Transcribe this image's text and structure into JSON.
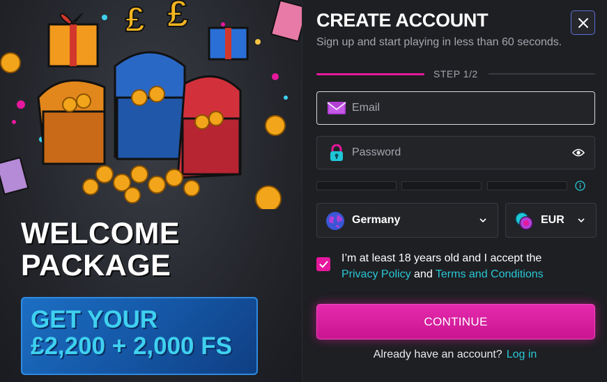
{
  "promo": {
    "headline_line1": "WELCOME",
    "headline_line2": "PACKAGE",
    "offer_line1": "GET YOUR",
    "offer_line2": "£2,200 + 2,000 FS"
  },
  "form": {
    "title": "CREATE ACCOUNT",
    "subtitle": "Sign up and start playing in less than 60 seconds.",
    "step_label": "STEP  1/2",
    "email_placeholder": "Email",
    "password_placeholder": "Password",
    "country": "Germany",
    "currency": "EUR",
    "consent_prefix": "I’m at least 18 years old and I accept the",
    "privacy_link": "Privacy Policy",
    "consent_and": "and",
    "terms_link": "Terms and Conditions",
    "consent_checked": true,
    "continue_label": "CONTINUE",
    "login_prompt": "Already have an account?",
    "login_link": "Log in"
  },
  "icons": {
    "close": "close-icon",
    "email": "envelope-icon",
    "password": "padlock-icon",
    "show_password": "eye-icon",
    "info": "info-icon",
    "country": "globe-icon",
    "currency": "coins-icon",
    "dropdown": "chevron-down-icon",
    "check": "checkmark-icon"
  },
  "colors": {
    "accent": "#e6189d",
    "link": "#28c8d6",
    "offer_text": "#3fd0f0",
    "offer_bg": "#1557a6"
  }
}
